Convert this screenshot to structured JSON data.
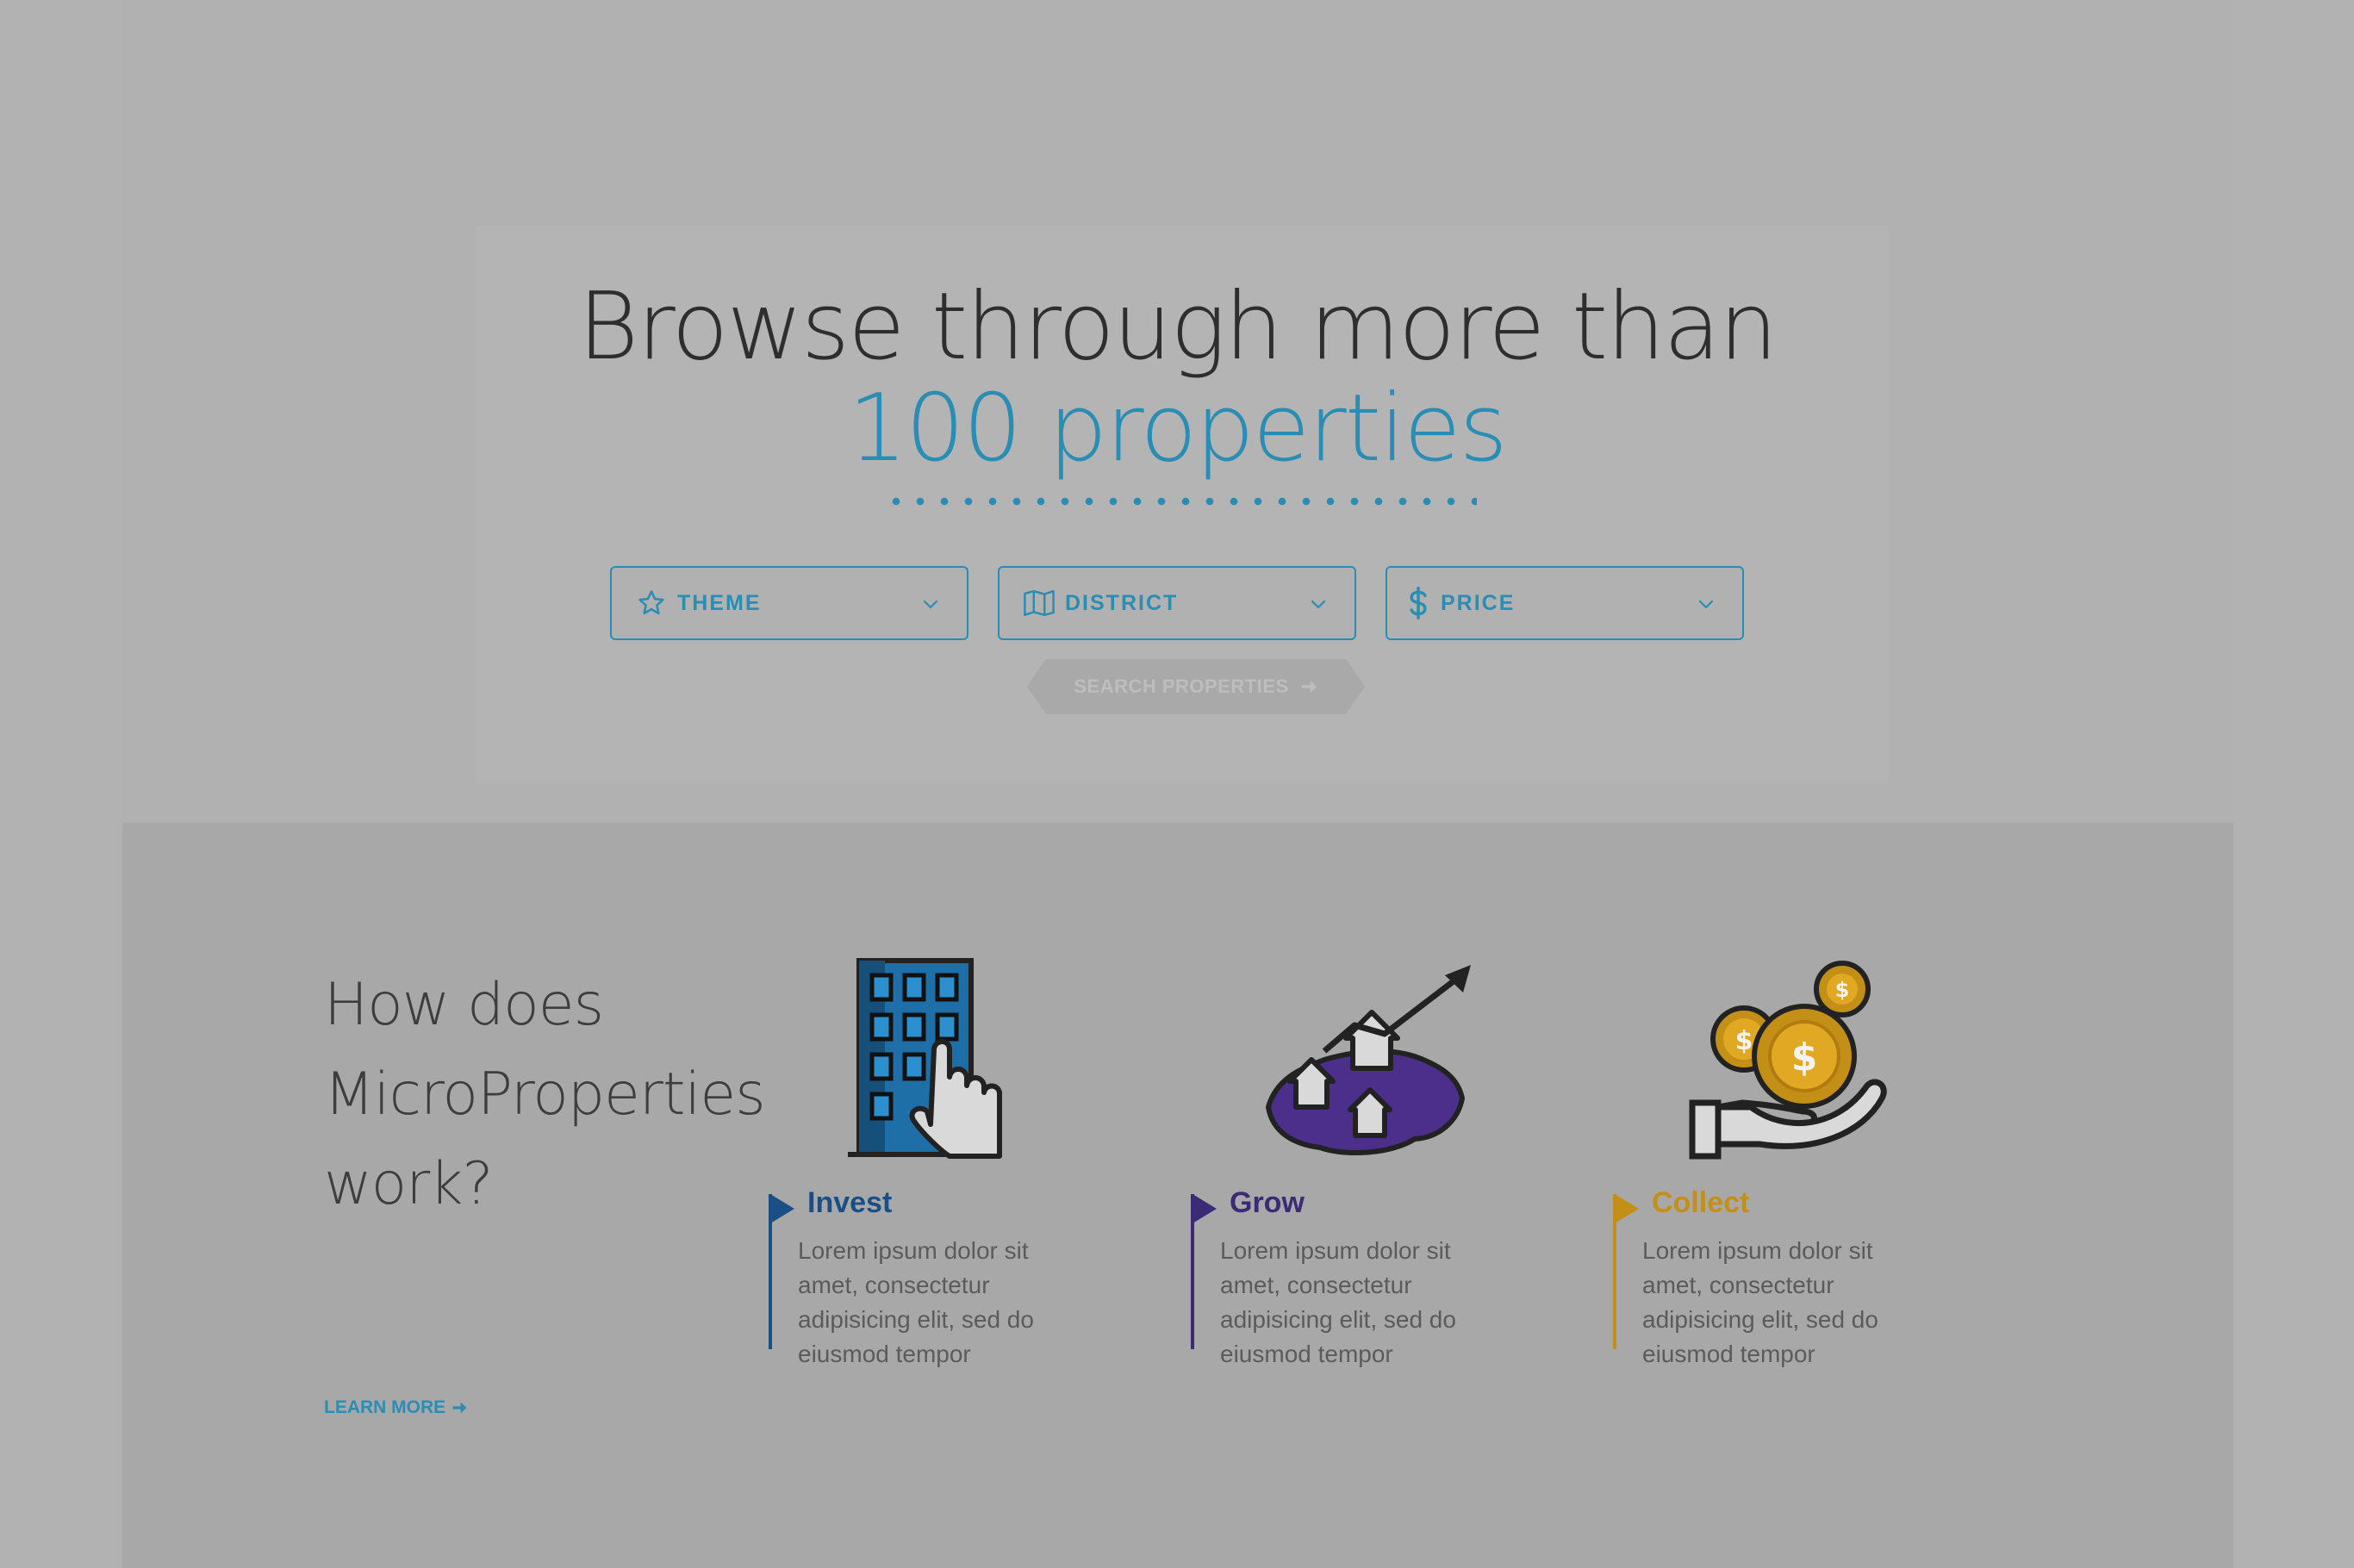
{
  "hero": {
    "headline": "Browse through more than",
    "headline_accent": "100 properties",
    "accent_color": "#2a8db4",
    "filters": [
      {
        "label": "THEME",
        "icon": "star-icon"
      },
      {
        "label": "DISTRICT",
        "icon": "map-icon"
      },
      {
        "label": "PRICE",
        "icon": "dollar-icon"
      }
    ],
    "search_button": "SEARCH PROPERTIES"
  },
  "how": {
    "title_lines": [
      "How does",
      "MicroProperties",
      "work?"
    ],
    "learn_more": "LEARN MORE",
    "steps": [
      {
        "title": "Invest",
        "color": "#1a4f86",
        "icon": "building-tap-icon",
        "description": "Lorem ipsum dolor sit amet, consectetur adipisicing elit, sed do eiusmod tempor"
      },
      {
        "title": "Grow",
        "color": "#3b2a75",
        "icon": "growth-map-icon",
        "description": "Lorem ipsum dolor sit amet, consectetur adipisicing elit, sed do eiusmod tempor"
      },
      {
        "title": "Collect",
        "color": "#c48f16",
        "icon": "coins-hand-icon",
        "description": "Lorem ipsum dolor sit amet, consectetur adipisicing elit, sed do eiusmod tempor"
      }
    ]
  }
}
